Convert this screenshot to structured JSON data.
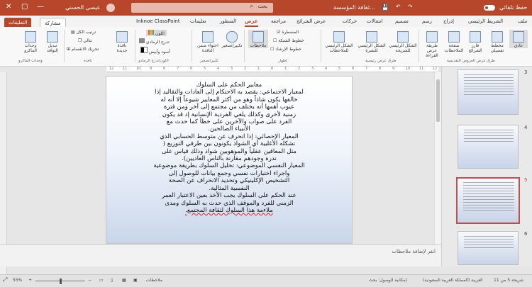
{
  "titlebar": {
    "autosave_label": "حفظ تلقائي",
    "file_title": "ثقافة المؤسسة...",
    "search_placeholder": "بحث",
    "user_name": "عيسى الحسني",
    "comments_label": "التعليقات",
    "share_label": "مشاركة"
  },
  "tabs": [
    "ملف",
    "الشريط الرئيسي",
    "إدراج",
    "رسم",
    "تصميم",
    "انتقالات",
    "حركات",
    "عرض الشرائح",
    "مراجعة",
    "عرض",
    "السطور",
    "تعليمات",
    "Inknoe ClassPoint"
  ],
  "active_tab": "عرض",
  "ribbon": {
    "groups": [
      {
        "label": "طرق عرض العروض التقديمية",
        "buttons": [
          "عادي",
          "مخطط تفصيلي",
          "فارز الشرائح",
          "صفحة الملاحظات",
          "طريقة عرض القراءة"
        ]
      },
      {
        "label": "طرق عرض رئيسية",
        "buttons": [
          "الشكل الرئيسي للشريحة",
          "الشكل الرئيسي للنشرة",
          "الشكل الرئيسي للملاحظات"
        ]
      },
      {
        "label": "إظهار",
        "checks": [
          "المسطرة",
          "خطوط الشبكة",
          "خطوط الإرشاد"
        ]
      },
      {
        "label": "",
        "buttons": [
          "ملاحظات"
        ]
      },
      {
        "label": "تكبير/تصغير",
        "buttons": [
          "تكبير/تصغير",
          "احتواء ضمن النافذة"
        ]
      },
      {
        "label": "اللون/تدرج الرمادي",
        "options": [
          "اللون",
          "تدرج الرمادي",
          "أسود وأبيض"
        ]
      },
      {
        "label": "نافذة",
        "buttons": [
          "نافذة جديدة",
          "ترتيب الكل",
          "تتالي",
          "تحريك الانقسام"
        ]
      },
      {
        "label": "وحدات الماكرو",
        "buttons": [
          "تبديل النوافذ",
          "وحدات الماكرو"
        ]
      }
    ]
  },
  "slide": {
    "title": "معايير الحكم على السلوك",
    "lines": [
      "لمعيار الاجتماعي: يقصد به الاحتكام إلى العادات والتقاليد إذا",
      "خالفها يكون شاذاً وهو من أكثر المعايير شيوعاً إلا أنه له",
      "عيوب أهمها أنه يختلف من مجتمع إلى آخر ومن فترة",
      "زمنية لأخرى وكذلك يلغي الفردية الإنسانية إذ قد يكون",
      "الفرد على صواب والآخرين على خطأ كما حدث مع",
      "الأنبياء الصالحين.",
      "المعيار الإحصائي: إذا انحرف عن متوسط الحسابي الذي",
      "تشكله الأغلبية أي الشواذ يكونون بين طرفي التوزيع (",
      "مثل المعاقين عقلياً والموهوبين شواذ وذلك قياس على",
      "ندرة وجودهم مقارنة بالناس العاديين).",
      "المعيار النفسي الموضوعي: تحليل السلوك بطريقة موضوعية",
      "واجراء اختبارات نفسي وجمع بيانات للوصول إلى",
      "التشخيص الإكلينيكي وتحديد الانحراف عن الصحة",
      "النفسية المثالية.",
      "عند الحكم على السلوك يجب الأخذ بعين الاعتبار العمر",
      "الزمني للفرد والموقف الذي حدث به السلوك ومدى",
      "ملاءمة هذا السلوك لثقافة المجتمع."
    ]
  },
  "notes_placeholder": "انقر لإضافة ملاحظات",
  "thumbnails": [
    {
      "number": "3",
      "selected": false
    },
    {
      "number": "4",
      "selected": false
    },
    {
      "number": "5",
      "selected": true
    },
    {
      "number": "6",
      "selected": false
    }
  ],
  "statusbar": {
    "slide_info": "شريحة 5 من 11",
    "language": "العربية (المملكة العربية السعودية)",
    "accessibility": "إمكانية الوصول: بحث",
    "notes": "ملاحظات",
    "zoom": "55%"
  }
}
